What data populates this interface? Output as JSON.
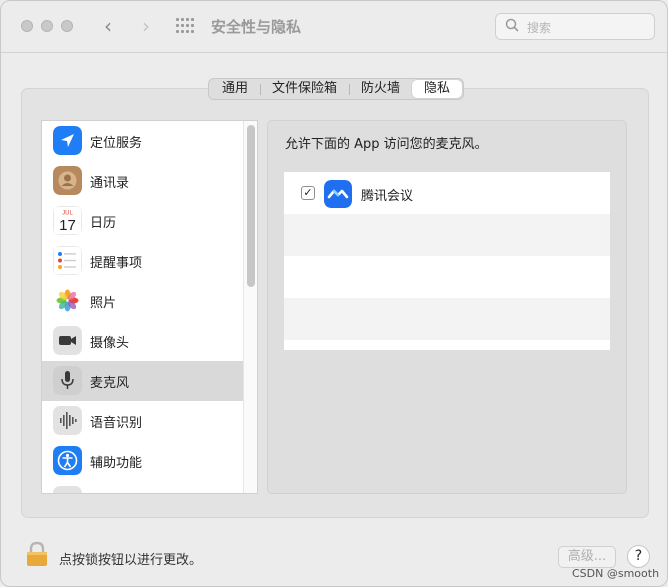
{
  "window": {
    "title": "安全性与隐私"
  },
  "search": {
    "placeholder": "搜索"
  },
  "tabs": [
    {
      "label": "通用",
      "active": false
    },
    {
      "label": "文件保险箱",
      "active": false
    },
    {
      "label": "防火墙",
      "active": false
    },
    {
      "label": "隐私",
      "active": true
    }
  ],
  "sidebar": {
    "items": [
      {
        "label": "定位服务",
        "icon": "location-icon",
        "selected": false
      },
      {
        "label": "通讯录",
        "icon": "contacts-icon",
        "selected": false
      },
      {
        "label": "日历",
        "icon": "calendar-icon",
        "selected": false,
        "icon_month": "JUL",
        "icon_day": "17"
      },
      {
        "label": "提醒事项",
        "icon": "reminders-icon",
        "selected": false
      },
      {
        "label": "照片",
        "icon": "photos-icon",
        "selected": false
      },
      {
        "label": "摄像头",
        "icon": "camera-icon",
        "selected": false
      },
      {
        "label": "麦克风",
        "icon": "microphone-icon",
        "selected": true
      },
      {
        "label": "语音识别",
        "icon": "speech-recognition-icon",
        "selected": false
      },
      {
        "label": "辅助功能",
        "icon": "accessibility-icon",
        "selected": false
      }
    ]
  },
  "main": {
    "description": "允许下面的 App 访问您的麦克风。",
    "apps": [
      {
        "name": "腾讯会议",
        "checked": true,
        "icon": "tencent-meeting-icon"
      }
    ]
  },
  "footer": {
    "lock_text": "点按锁按钮以进行更改。",
    "advanced_label": "高级...",
    "help_label": "?"
  },
  "watermark": "CSDN @smooth",
  "colors": {
    "selection": "#d9d9d9",
    "accent_blue": "#1f7ef5"
  }
}
